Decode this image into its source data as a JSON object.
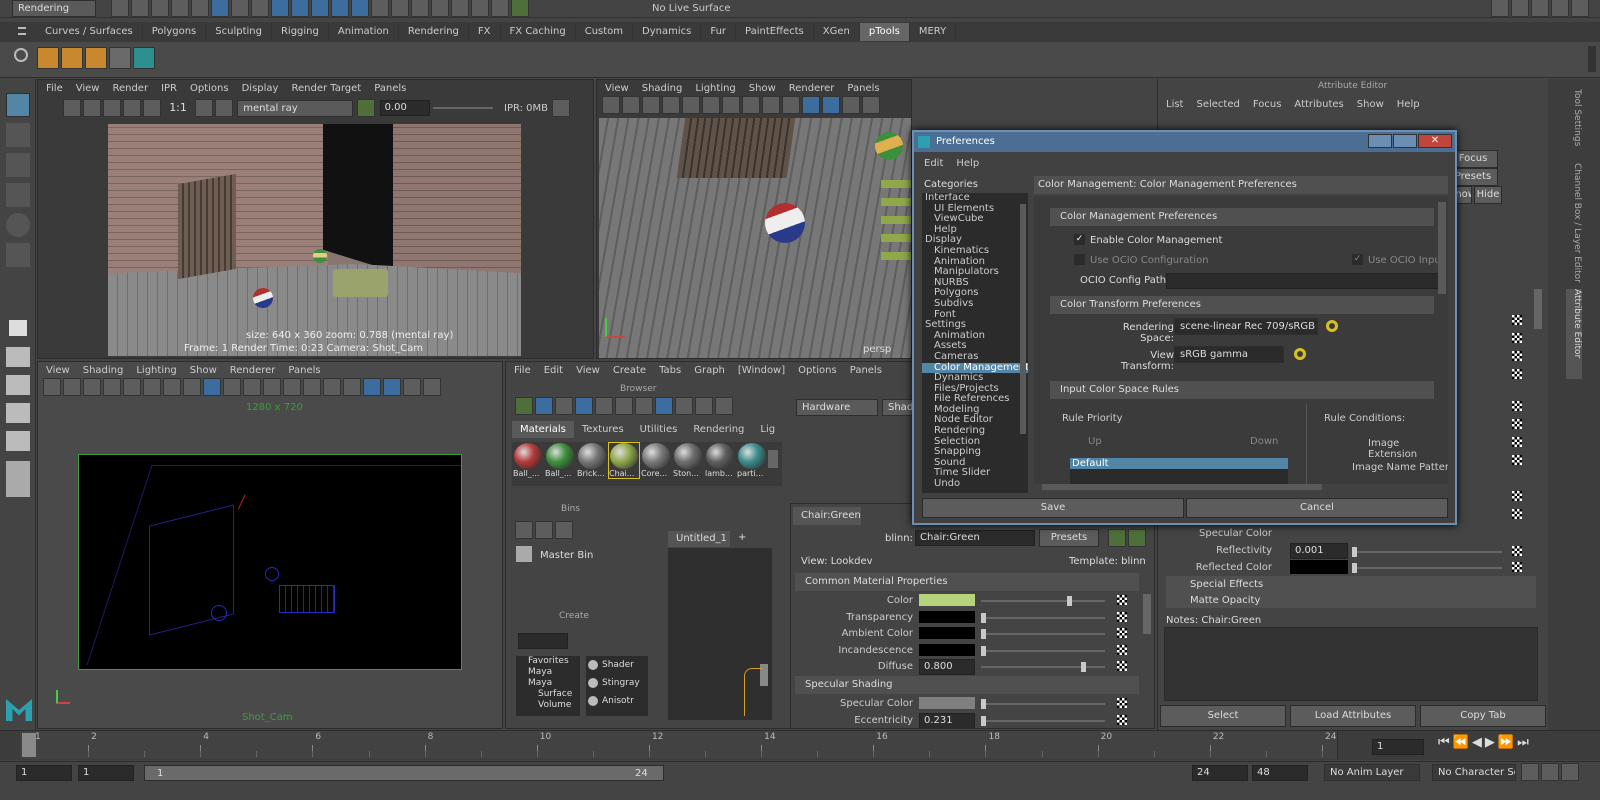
{
  "top_bar": {
    "mode_menu": "Rendering",
    "live_surface": "No Live Surface"
  },
  "shelf": {
    "tabs": [
      "Curves / Surfaces",
      "Polygons",
      "Sculpting",
      "Rigging",
      "Animation",
      "Rendering",
      "FX",
      "FX Caching",
      "Custom",
      "Dynamics",
      "Fur",
      "PaintEffects",
      "XGen",
      "pTools",
      "MERY"
    ],
    "active": "pTools"
  },
  "render_view": {
    "menu": [
      "File",
      "View",
      "Render",
      "IPR",
      "Options",
      "Display",
      "Render Target",
      "Panels"
    ],
    "ratio": "1:1",
    "renderer": "mental ray",
    "exposure": "0.00",
    "ipr": "IPR: 0MB",
    "info_line1": "size: 640 x 360  zoom: 0.788      (mental ray)",
    "info_line2": "Frame: 1      Render Time: 0:23      Camera: Shot_Cam"
  },
  "viewport_top": {
    "menu": [
      "View",
      "Shading",
      "Lighting",
      "Show",
      "Renderer",
      "Panels"
    ],
    "camera": "persp"
  },
  "viewport_bottom": {
    "menu": [
      "View",
      "Shading",
      "Lighting",
      "Show",
      "Renderer",
      "Panels"
    ],
    "resolution": "1280 x 720",
    "camera": "Shot_Cam"
  },
  "hypershade": {
    "menu": [
      "File",
      "Edit",
      "View",
      "Create",
      "Tabs",
      "Graph",
      "[Window]",
      "Options",
      "Panels"
    ],
    "browser_title": "Browser",
    "tabs": [
      "Materials",
      "Textures",
      "Utilities",
      "Rendering",
      "Lig"
    ],
    "materials": [
      {
        "label": "Ball_...",
        "color": "#b53a3a"
      },
      {
        "label": "Ball_...",
        "color": "#3f8f3f"
      },
      {
        "label": "Brick...",
        "color": "#777777"
      },
      {
        "label": "Chai...",
        "color": "#8fa84a"
      },
      {
        "label": "Core...",
        "color": "#7a7a7a"
      },
      {
        "label": "Ston...",
        "color": "#6e6e6e"
      },
      {
        "label": "lamb...",
        "color": "#5f5f5f"
      },
      {
        "label": "parti...",
        "color": "#3d8c8c"
      }
    ],
    "bins_title": "Bins",
    "master_bin": "Master Bin",
    "create_title": "Create",
    "create_tree": [
      "Favorites",
      "Maya",
      "Maya",
      "Surface",
      "Volume"
    ],
    "create_list": [
      "Shader",
      "Stingray",
      "Anisotr"
    ],
    "graph_tab": "Untitled_1",
    "renderer_dropdown": "Hardware",
    "shade_dropdown": "Shade"
  },
  "property_editor": {
    "tab": "Chair:Green",
    "node_type": "blinn:",
    "node_name": "Chair:Green",
    "presets": "Presets",
    "view": "View: Lookdev",
    "template": "Template: blinn",
    "section1": "Common Material Properties",
    "rows": [
      {
        "label": "Color",
        "value": "",
        "swatch": "#b5d47c"
      },
      {
        "label": "Transparency",
        "value": "",
        "swatch": "#000000"
      },
      {
        "label": "Ambient Color",
        "value": "",
        "swatch": "#000000"
      },
      {
        "label": "Incandescence",
        "value": "",
        "swatch": "#000000"
      },
      {
        "label": "Diffuse",
        "value": "0.800",
        "swatch": ""
      }
    ],
    "section2": "Specular Shading",
    "rows2": [
      {
        "label": "Specular Color",
        "value": "",
        "swatch": "#808080"
      },
      {
        "label": "Eccentricity",
        "value": "0.231",
        "swatch": ""
      }
    ]
  },
  "attribute_editor": {
    "title": "Attribute Editor",
    "menu": [
      "List",
      "Selected",
      "Focus",
      "Attributes",
      "Show",
      "Help"
    ],
    "focus_btn": "Focus",
    "presets_btn": "Presets",
    "show_btn": "Show",
    "hide_btn": "Hide",
    "specular_color": "Specular Color",
    "reflectivity_label": "Reflectivity",
    "reflectivity_value": "0.001",
    "reflected_color": "Reflected Color",
    "special_effects": "Special Effects",
    "matte_opacity": "Matte Opacity",
    "notes": "Notes:  Chair:Green",
    "buttons": [
      "Select",
      "Load Attributes",
      "Copy Tab"
    ]
  },
  "side_tabs": [
    "Tool Settings",
    "Channel Box / Layer Editor",
    "Attribute Editor"
  ],
  "preferences": {
    "title": "Preferences",
    "menu": [
      "Edit",
      "Help"
    ],
    "categories_title": "Categories",
    "categories": [
      {
        "label": "Interface",
        "sub": false
      },
      {
        "label": "UI Elements",
        "sub": true
      },
      {
        "label": "ViewCube",
        "sub": true
      },
      {
        "label": "Help",
        "sub": true
      },
      {
        "label": "Display",
        "sub": false
      },
      {
        "label": "Kinematics",
        "sub": true
      },
      {
        "label": "Animation",
        "sub": true
      },
      {
        "label": "Manipulators",
        "sub": true
      },
      {
        "label": "NURBS",
        "sub": true
      },
      {
        "label": "Polygons",
        "sub": true
      },
      {
        "label": "Subdivs",
        "sub": true
      },
      {
        "label": "Font",
        "sub": true
      },
      {
        "label": "Settings",
        "sub": false
      },
      {
        "label": "Animation",
        "sub": true
      },
      {
        "label": "Assets",
        "sub": true
      },
      {
        "label": "Cameras",
        "sub": true
      },
      {
        "label": "Color Management",
        "sub": true
      },
      {
        "label": "Dynamics",
        "sub": true
      },
      {
        "label": "Files/Projects",
        "sub": true
      },
      {
        "label": "File References",
        "sub": true
      },
      {
        "label": "Modeling",
        "sub": true
      },
      {
        "label": "Node Editor",
        "sub": true
      },
      {
        "label": "Rendering",
        "sub": true
      },
      {
        "label": "Selection",
        "sub": true
      },
      {
        "label": "Snapping",
        "sub": true
      },
      {
        "label": "Sound",
        "sub": true
      },
      {
        "label": "Time Slider",
        "sub": true
      },
      {
        "label": "Undo",
        "sub": true
      }
    ],
    "selected_category": "Color Management",
    "header": "Color Management: Color Management Preferences",
    "section_cm": "Color Management Preferences",
    "enable_cm": "Enable Color Management",
    "use_ocio": "Use OCIO Configuration",
    "use_ocio_input": "Use OCIO Input Color Sp",
    "ocio_path_label": "OCIO Config Path:",
    "section_ct": "Color Transform Preferences",
    "rendering_space_label": "Rendering Space:",
    "rendering_space": "scene-linear Rec 709/sRGB",
    "view_transform_label": "View Transform:",
    "view_transform": "sRGB gamma",
    "section_rules": "Input Color Space Rules",
    "rule_priority": "Rule Priority",
    "rule_conditions": "Rule Conditions:",
    "up": "Up",
    "down": "Down",
    "rule_default": "Default",
    "image_extension": "Image Extension",
    "image_name_pattern": "Image Name Patter",
    "save": "Save",
    "cancel": "Cancel"
  },
  "timeline": {
    "ticks": [
      "1",
      "2",
      "4",
      "6",
      "8",
      "10",
      "12",
      "14",
      "16",
      "18",
      "20",
      "22",
      "24"
    ],
    "current_frame": "1"
  },
  "range_bar": {
    "start": "1",
    "playback_start": "1",
    "range_label_left": "1",
    "range_label_right": "24",
    "playback_end": "24",
    "end": "48",
    "anim_layer": "No Anim Layer",
    "character_set": "No Character Set"
  }
}
